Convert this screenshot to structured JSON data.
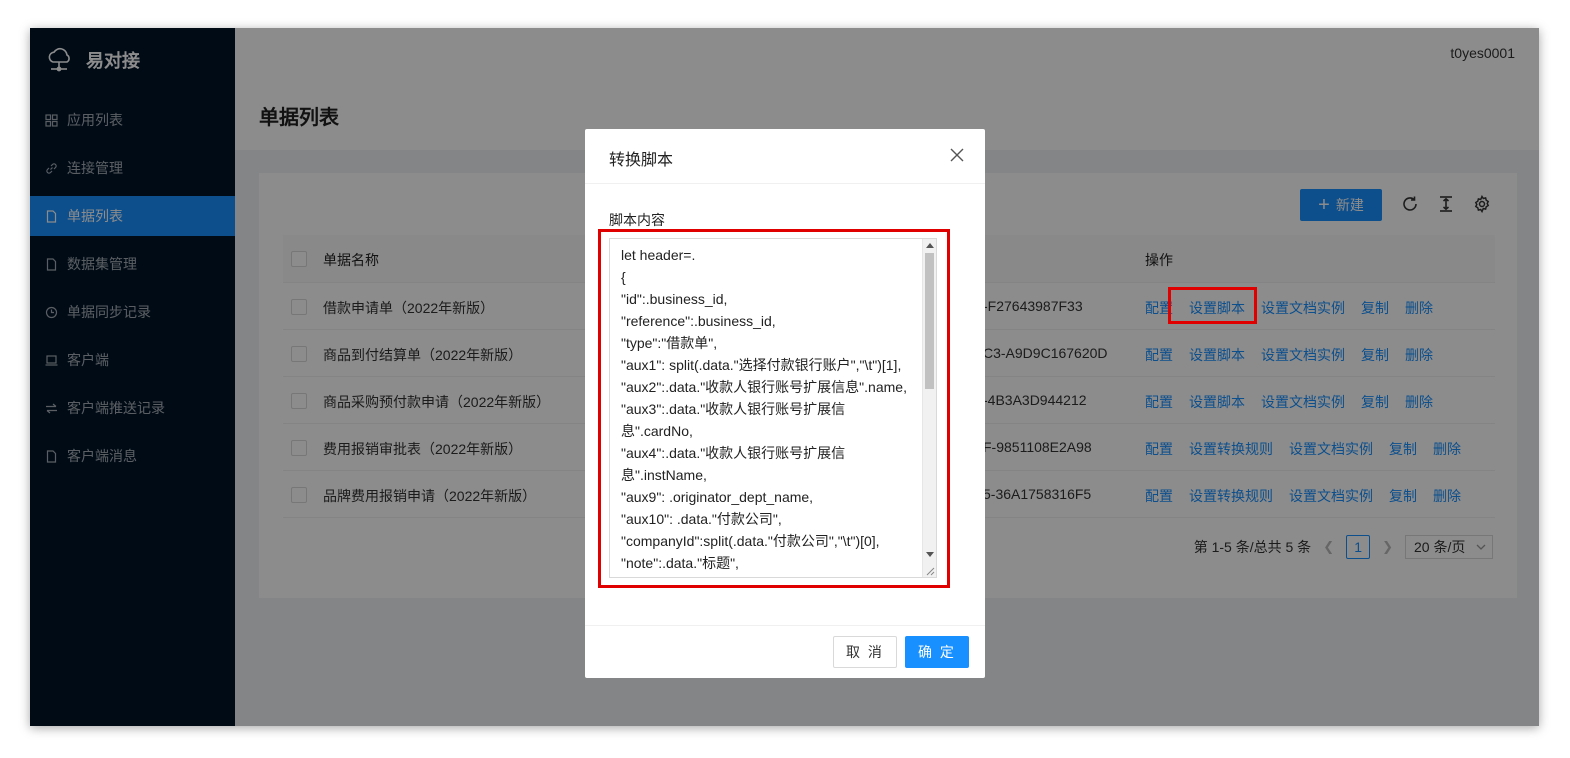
{
  "app": {
    "title": "易对接",
    "user": "t0yes0001"
  },
  "sidebar": {
    "items": [
      {
        "label": "应用列表",
        "icon": "grid-icon"
      },
      {
        "label": "连接管理",
        "icon": "link-icon"
      },
      {
        "label": "单据列表",
        "icon": "file-icon",
        "active": true
      },
      {
        "label": "数据集管理",
        "icon": "file-icon"
      },
      {
        "label": "单据同步记录",
        "icon": "history-icon"
      },
      {
        "label": "客户端",
        "icon": "laptop-icon"
      },
      {
        "label": "客户端推送记录",
        "icon": "swap-icon"
      },
      {
        "label": "客户端消息",
        "icon": "file-icon"
      }
    ]
  },
  "page": {
    "title": "单据列表"
  },
  "toolbar": {
    "new_label": "新建"
  },
  "table": {
    "headers": {
      "name": "单据名称",
      "ops": "操作"
    },
    "rows": [
      {
        "name": "借款申请单（2022年新版）",
        "col2": "",
        "id": "-F27643987F33",
        "ops": [
          "配置",
          "设置脚本",
          "设置文档实例",
          "复制",
          "删除"
        ]
      },
      {
        "name": "商品到付结算单（2022年新版）",
        "col2": "",
        "id": "C3-A9D9C167620D",
        "ops": [
          "配置",
          "设置脚本",
          "设置文档实例",
          "复制",
          "删除"
        ]
      },
      {
        "name": "商品采购预付款申请（2022年新版）",
        "col2": "",
        "id": "-4B3A3D944212",
        "ops": [
          "配置",
          "设置脚本",
          "设置文档实例",
          "复制",
          "删除"
        ]
      },
      {
        "name": "费用报销审批表（2022年新版）",
        "col2": "",
        "id": "F-9851108E2A98",
        "ops": [
          "配置",
          "设置转换规则",
          "设置文档实例",
          "复制",
          "删除"
        ]
      },
      {
        "name": "品牌费用报销申请（2022年新版）",
        "col2": "",
        "id": "5-36A1758316F5",
        "ops": [
          "配置",
          "设置转换规则",
          "设置文档实例",
          "复制",
          "删除"
        ]
      }
    ]
  },
  "pagination": {
    "summary": "第 1-5 条/总共 5 条",
    "current": "1",
    "page_size": "20 条/页"
  },
  "modal": {
    "title": "转换脚本",
    "field_label": "脚本内容",
    "script_lines": [
      "let header=.",
      "{",
      "\"id\":.business_id,",
      "\"reference\":.business_id,",
      "\"type\":\"借款单\",",
      "\"aux1\": split(.data.\"选择付款银行账户\",\"\\t\")[1],",
      "\"aux2\":.data.\"收款人银行账号扩展信息\".name,",
      "\"aux3\":.data.\"收款人银行账号扩展信",
      "息\".cardNo,",
      "\"aux4\":.data.\"收款人银行账号扩展信",
      "息\".instName,",
      "\"aux9\": .originator_dept_name,",
      "\"aux10\": .data.\"付款公司\",",
      "\"companyId\":split(.data.\"付款公司\",\"\\t\")[0],",
      "\"note\":.data.\"标题\","
    ],
    "cancel_label": "取 消",
    "ok_label": "确 定"
  },
  "colors": {
    "sidebar": "#001529",
    "primary": "#1890ff",
    "highlight": "#e00000"
  }
}
